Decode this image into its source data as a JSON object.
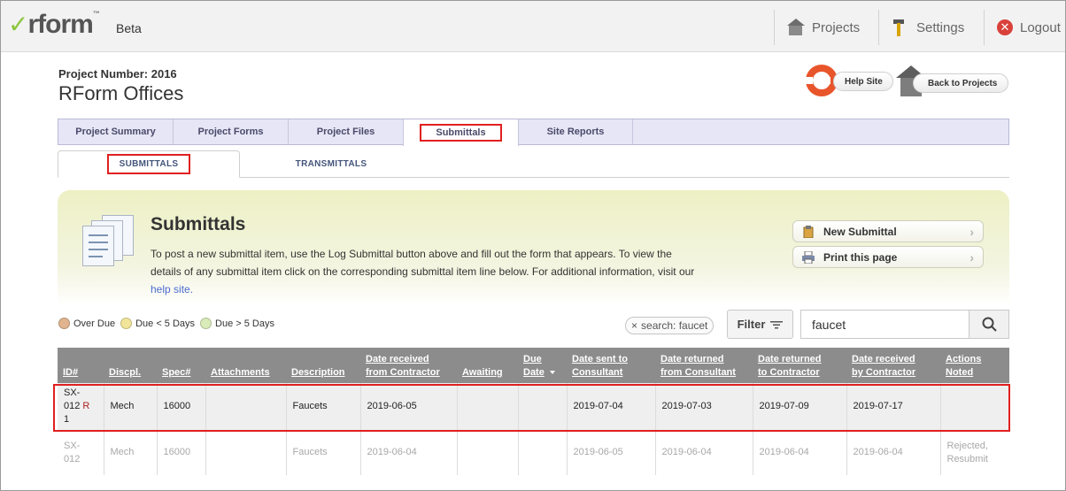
{
  "app": {
    "logo_text": "rform",
    "logo_tm": "™",
    "badge": "Beta",
    "nav": {
      "projects": "Projects",
      "settings": "Settings",
      "logout": "Logout"
    }
  },
  "project": {
    "number": "Project Number: 2016",
    "name": "RForm Offices",
    "help_site": "Help Site",
    "back_to_projects": "Back to Projects"
  },
  "tabs": [
    "Project Summary",
    "Project Forms",
    "Project Files",
    "Submittals",
    "Site Reports"
  ],
  "subtabs": [
    "SUBMITTALS",
    "TRANSMITTALS"
  ],
  "banner": {
    "title": "Submittals",
    "text": "To post a new submittal item, use the Log Submittal button above and fill out the form that appears. To view the details of any submittal item click on the corresponding submittal item line below. For additional information, visit our ",
    "link": "help site.",
    "new_submittal": "New Submittal",
    "print_page": "Print this page"
  },
  "legend": {
    "over_due": "Over Due",
    "due_lt5": "Due < 5 Days",
    "due_gt5": "Due > 5 Days",
    "colors": {
      "over_due": "#e0b48e",
      "due_lt5": "#f1e59a",
      "due_gt5": "#d9ebb8"
    }
  },
  "search": {
    "chip": "search: faucet",
    "filter": "Filter",
    "value": "faucet"
  },
  "table": {
    "headers": {
      "id": "ID#",
      "discpl": "Discpl.",
      "spec": "Spec#",
      "attachments": "Attachments",
      "description": "Description",
      "received_contractor_1": "Date received",
      "received_contractor_2": "from Contractor",
      "awaiting": "Awaiting",
      "due_1": "Due",
      "due_2": "Date",
      "sent_consultant_1": "Date sent to",
      "sent_consultant_2": "Consultant",
      "returned_consultant_1": "Date returned",
      "returned_consultant_2": "from Consultant",
      "returned_contractor_1": "Date returned",
      "returned_contractor_2": "to Contractor",
      "received_by_contractor_1": "Date received",
      "received_by_contractor_2": "by Contractor",
      "actions_1": "Actions",
      "actions_2": "Noted"
    },
    "rows": [
      {
        "id_a": "SX-",
        "id_b": "012",
        "id_rev": "R",
        "id_c": "1",
        "discpl": "Mech",
        "spec": "16000",
        "attachments": "",
        "description": "Faucets",
        "received_contractor": "2019-06-05",
        "awaiting": "",
        "due": "",
        "sent_consultant": "2019-07-04",
        "returned_consultant": "2019-07-03",
        "returned_contractor": "2019-07-09",
        "received_by_contractor": "2019-07-17",
        "actions": ""
      },
      {
        "id_a": "SX-",
        "id_b": "012",
        "discpl": "Mech",
        "spec": "16000",
        "attachments": "",
        "description": "Faucets",
        "received_contractor": "2019-06-04",
        "awaiting": "",
        "due": "",
        "sent_consultant": "2019-06-05",
        "returned_consultant": "2019-06-04",
        "returned_contractor": "2019-06-04",
        "received_by_contractor": "2019-06-04",
        "actions_1": "Rejected,",
        "actions_2": "Resubmit"
      }
    ]
  }
}
